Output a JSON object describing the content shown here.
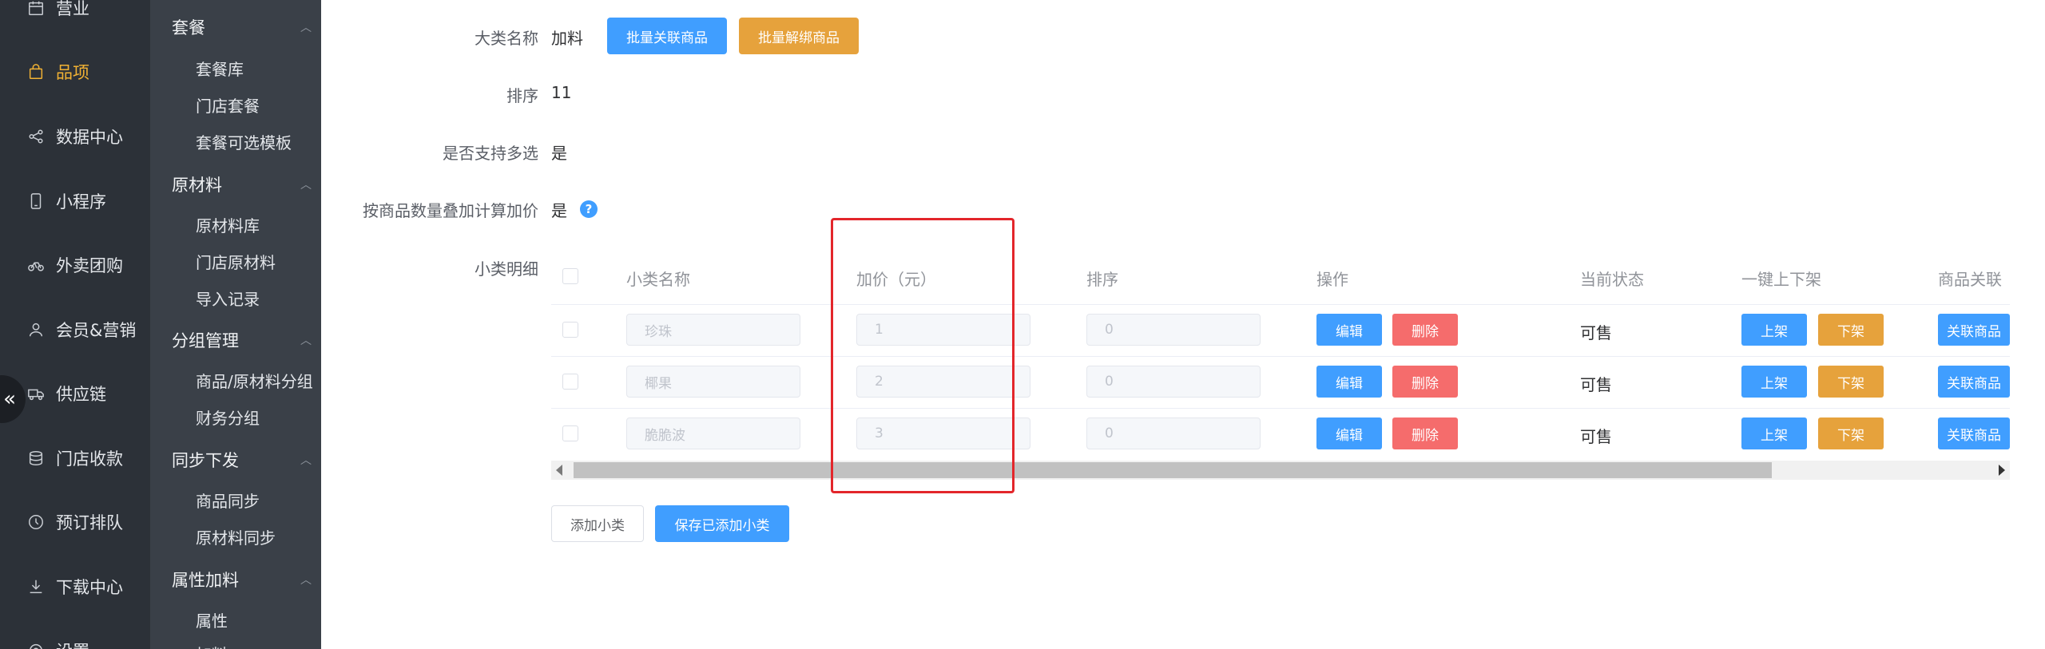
{
  "nav": {
    "items": [
      {
        "label": "营业",
        "icon": "calendar-icon"
      },
      {
        "label": "品项",
        "icon": "bag-icon",
        "active": true
      },
      {
        "label": "数据中心",
        "icon": "share-icon"
      },
      {
        "label": "小程序",
        "icon": "phone-icon"
      },
      {
        "label": "外卖团购",
        "icon": "bike-icon"
      },
      {
        "label": "会员&营销",
        "icon": "user-icon"
      },
      {
        "label": "供应链",
        "icon": "truck-icon"
      },
      {
        "label": "门店收款",
        "icon": "database-icon"
      },
      {
        "label": "预订排队",
        "icon": "clock-icon"
      },
      {
        "label": "下载中心",
        "icon": "download-icon"
      },
      {
        "label": "设置",
        "icon": "settings-icon"
      }
    ],
    "collapse_glyph": "«"
  },
  "subnav": {
    "groups": [
      {
        "label": "套餐",
        "items": [
          "套餐库",
          "门店套餐",
          "套餐可选模板"
        ]
      },
      {
        "label": "原材料",
        "items": [
          "原材料库",
          "门店原材料",
          "导入记录"
        ]
      },
      {
        "label": "分组管理",
        "items": [
          "商品/原材料分组",
          "财务分组"
        ]
      },
      {
        "label": "同步下发",
        "items": [
          "商品同步",
          "原材料同步"
        ]
      },
      {
        "label": "属性加料",
        "items": [
          "属性",
          "加料"
        ]
      }
    ]
  },
  "form": {
    "category_name_label": "大类名称",
    "category_name_value": "加料",
    "batch_link_button": "批量关联商品",
    "batch_unbind_button": "批量解绑商品",
    "sort_label": "排序",
    "sort_value": "11",
    "multi_select_label": "是否支持多选",
    "multi_select_value": "是",
    "stack_price_label": "按商品数量叠加计算加价",
    "stack_price_value": "是",
    "help_glyph": "?",
    "detail_label": "小类明细"
  },
  "table": {
    "headers": {
      "name": "小类名称",
      "price": "加价（元）",
      "sort": "排序",
      "action": "操作",
      "status": "当前状态",
      "shelf": "一键上下架",
      "link": "商品关联"
    },
    "rows": [
      {
        "name": "珍珠",
        "price": "1",
        "sort": "0",
        "status": "可售"
      },
      {
        "name": "椰果",
        "price": "2",
        "sort": "0",
        "status": "可售"
      },
      {
        "name": "脆脆波",
        "price": "3",
        "sort": "0",
        "status": "可售"
      }
    ],
    "edit_label": "编辑",
    "delete_label": "删除",
    "on_shelf_label": "上架",
    "off_shelf_label": "下架",
    "link_label": "关联商品"
  },
  "footer": {
    "add_sub_button": "添加小类",
    "save_button": "保存已添加小类"
  },
  "colors": {
    "primary": "#409eff",
    "warning": "#e6a23c",
    "danger": "#f56c6c",
    "active_nav": "#f2b233",
    "highlight": "#e3262b"
  }
}
